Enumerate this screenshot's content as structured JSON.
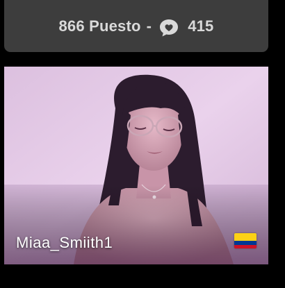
{
  "rank": {
    "position_text": "866 Puesto",
    "separator": "-",
    "chat_icon": "chat-bubble-heart-icon",
    "count": "415"
  },
  "stream": {
    "username": "Miaa_Smiith1",
    "country_flag": "colombia-flag-icon",
    "flag_colors": {
      "yellow": "#fcd116",
      "blue": "#003893",
      "red": "#ce1126"
    }
  },
  "colors": {
    "banner_bg": "#3d3d3d",
    "banner_text": "#d9d9d9",
    "page_bg": "#000000",
    "photo_tint": "#e2c3e6"
  }
}
